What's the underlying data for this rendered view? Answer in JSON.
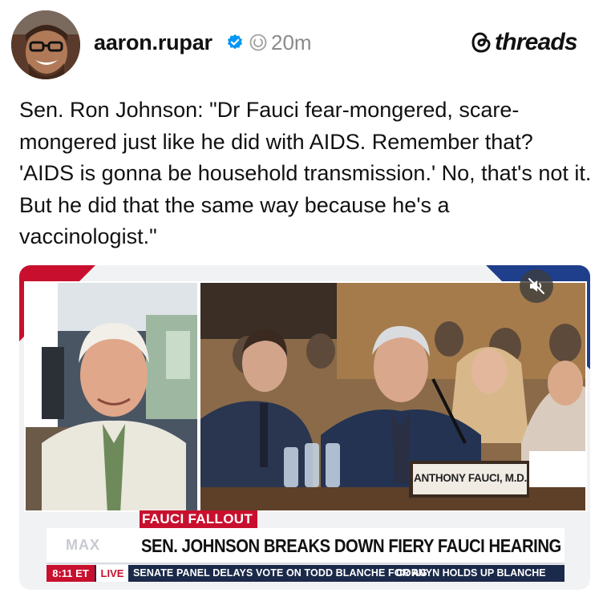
{
  "post": {
    "username": "aaron.rupar",
    "time": "20m",
    "brand": "threads",
    "text": "Sen. Ron Johnson: \"Dr Fauci fear-mongered, scare-mongered just like he did with AIDS. Remember that? 'AIDS is gonna be household transmission.' No, that's not it. But he did that the same way because he's a vaccinologist.\""
  },
  "video": {
    "nameplate": "ANTHONY FAUCI, M.D.",
    "channel_logo": "MAX",
    "banner": "FAUCI FALLOUT",
    "headline": "SEN. JOHNSON BREAKS DOWN FIERY FAUCI HEARING",
    "ticker_time": "8:11 ET",
    "ticker_live": "LIVE",
    "ticker_text_1": "SENATE PANEL DELAYS VOTE ON TODD BLANCHE FOR AG",
    "ticker_text_2": "CORNYN HOLDS UP BLANCHE",
    "mute_icon": "speaker-muted-icon"
  },
  "colors": {
    "accent_red": "#c8102e",
    "accent_blue": "#1f3f8c",
    "verified_blue": "#0095f6"
  }
}
